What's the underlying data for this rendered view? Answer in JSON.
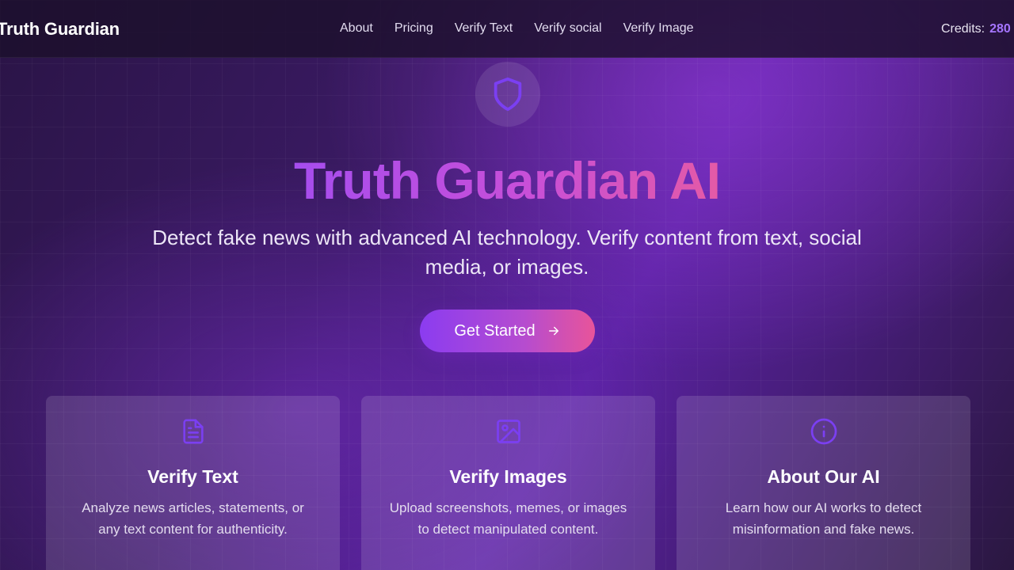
{
  "navbar": {
    "brand": "Truth Guardian",
    "links": [
      "About",
      "Pricing",
      "Verify Text",
      "Verify social",
      "Verify Image"
    ],
    "credits_label": "Credits:",
    "credits_value": "280"
  },
  "hero": {
    "icon": "shield-icon",
    "title": "Truth Guardian AI",
    "subtitle": "Detect fake news with advanced AI technology. Verify content from text, social media, or images.",
    "cta_label": "Get Started",
    "cta_icon": "arrow-right-icon"
  },
  "cards": [
    {
      "icon": "document-icon",
      "title": "Verify Text",
      "description": "Analyze news articles, statements, or any text content for authenticity."
    },
    {
      "icon": "image-icon",
      "title": "Verify Images",
      "description": "Upload screenshots, memes, or images to detect manipulated content."
    },
    {
      "icon": "info-icon",
      "title": "About Our AI",
      "description": "Learn how our AI works to detect misinformation and fake news."
    }
  ],
  "colors": {
    "accent": "#8b3cf0",
    "accent_pink": "#e8549a",
    "icon_purple": "#7b3ff2",
    "credits": "#a575ff"
  }
}
